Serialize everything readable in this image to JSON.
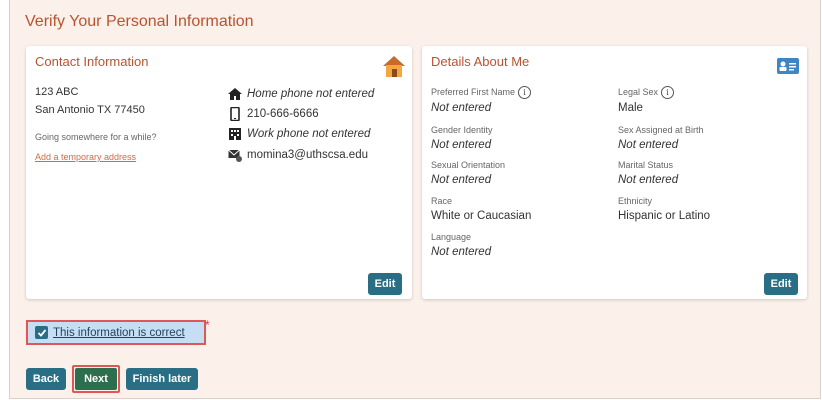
{
  "page": {
    "title": "Verify Your Personal Information"
  },
  "contact": {
    "title": "Contact Information",
    "address_line1": "123 ABC",
    "address_line2": "San Antonio TX 77450",
    "going_somewhere": "Going somewhere for a while?",
    "temp_address_link": "Add a temporary address",
    "home_phone": "Home phone not entered",
    "mobile_phone": "210-666-6666",
    "work_phone": "Work phone not entered",
    "email": "momina3@uthscsa.edu",
    "edit_label": "Edit"
  },
  "details": {
    "title": "Details About Me",
    "fields": [
      {
        "label": "Preferred First Name",
        "value": "Not entered",
        "info": true
      },
      {
        "label": "Legal Sex",
        "value": "Male",
        "info": true
      },
      {
        "label": "Gender Identity",
        "value": "Not entered"
      },
      {
        "label": "Sex Assigned at Birth",
        "value": "Not entered"
      },
      {
        "label": "Sexual Orientation",
        "value": "Not entered"
      },
      {
        "label": "Marital Status",
        "value": "Not entered"
      },
      {
        "label": "Race",
        "value": "White or Caucasian"
      },
      {
        "label": "Ethnicity",
        "value": "Hispanic or Latino"
      },
      {
        "label": "Language",
        "value": "Not entered"
      }
    ],
    "edit_label": "Edit"
  },
  "confirm": {
    "label": "This information is correct",
    "required_mark": "*",
    "checked": true
  },
  "buttons": {
    "back": "Back",
    "next": "Next",
    "finish_later": "Finish later"
  },
  "colors": {
    "accent": "#b9532f",
    "button": "#2a6e86",
    "next_button": "#2d6e4e",
    "highlight": "#e05555"
  }
}
